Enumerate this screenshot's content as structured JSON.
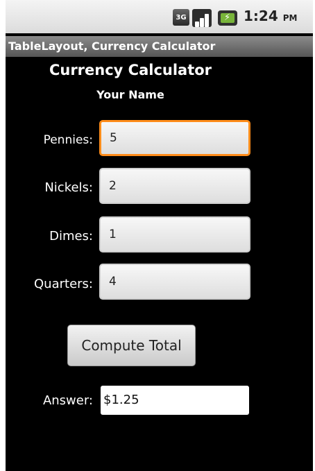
{
  "status_bar": {
    "network_type": "3G",
    "time": "1:24",
    "ampm": "PM",
    "icons": [
      "3g-icon",
      "signal-icon",
      "battery-charging-icon"
    ]
  },
  "app": {
    "title": "TableLayout, Currency Calculator"
  },
  "header": {
    "title": "Currency Calculator",
    "subtitle": "Your Name"
  },
  "form": {
    "pennies_label": "Pennies:",
    "pennies_value": "5",
    "nickels_label": "Nickels:",
    "nickels_value": "2",
    "dimes_label": "Dimes:",
    "dimes_value": "1",
    "quarters_label": "Quarters:",
    "quarters_value": "4",
    "compute_button": "Compute Total",
    "answer_label": "Answer:",
    "answer_value": "$1.25"
  },
  "colors": {
    "focus_accent": "#ff8c1a",
    "background": "#000000"
  }
}
